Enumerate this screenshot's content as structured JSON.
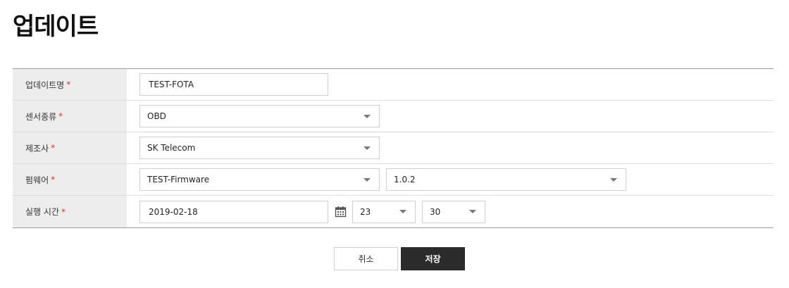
{
  "page": {
    "title": "업데이트"
  },
  "form": {
    "required_mark": "*",
    "update_name": {
      "label": "업데이트명",
      "value": "TEST-FOTA"
    },
    "sensor_type": {
      "label": "센서종류",
      "value": "OBD"
    },
    "manufacturer": {
      "label": "제조사",
      "value": "SK Telecom"
    },
    "firmware": {
      "label": "펌웨어",
      "value": "TEST-Firmware",
      "version": "1.0.2"
    },
    "exec_time": {
      "label": "실행 시간",
      "date": "2019-02-18",
      "hour": "23",
      "minute": "30"
    }
  },
  "buttons": {
    "cancel": "취소",
    "save": "저장"
  },
  "icons": {
    "calendar": "calendar-icon",
    "dropdown": "chevron-down-icon"
  },
  "colors": {
    "required": "#d9332a",
    "primary_button": "#2b2b2b",
    "label_bg": "#ededed"
  }
}
